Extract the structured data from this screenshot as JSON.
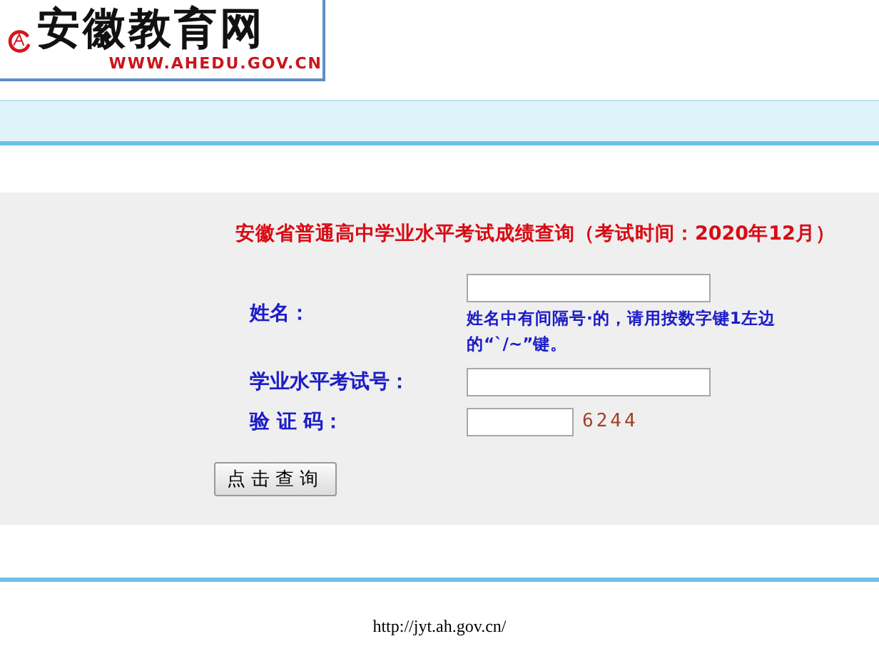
{
  "logo": {
    "title": "安徽教育网",
    "url": "WWW.AHEDU.GOV.CN"
  },
  "form": {
    "title": "安徽省普通高中学业水平考试成绩查询（考试时间：2020年12月）",
    "name_label": "姓名：",
    "name_hint": "姓名中有间隔号·的，请用按数字键1左边的“`/~”键。",
    "exam_label": "学业水平考试号：",
    "code_label": "验 证 码：",
    "captcha": "6244",
    "submit": "点击查询"
  },
  "footer": {
    "url": "http://jyt.ah.gov.cn/"
  }
}
